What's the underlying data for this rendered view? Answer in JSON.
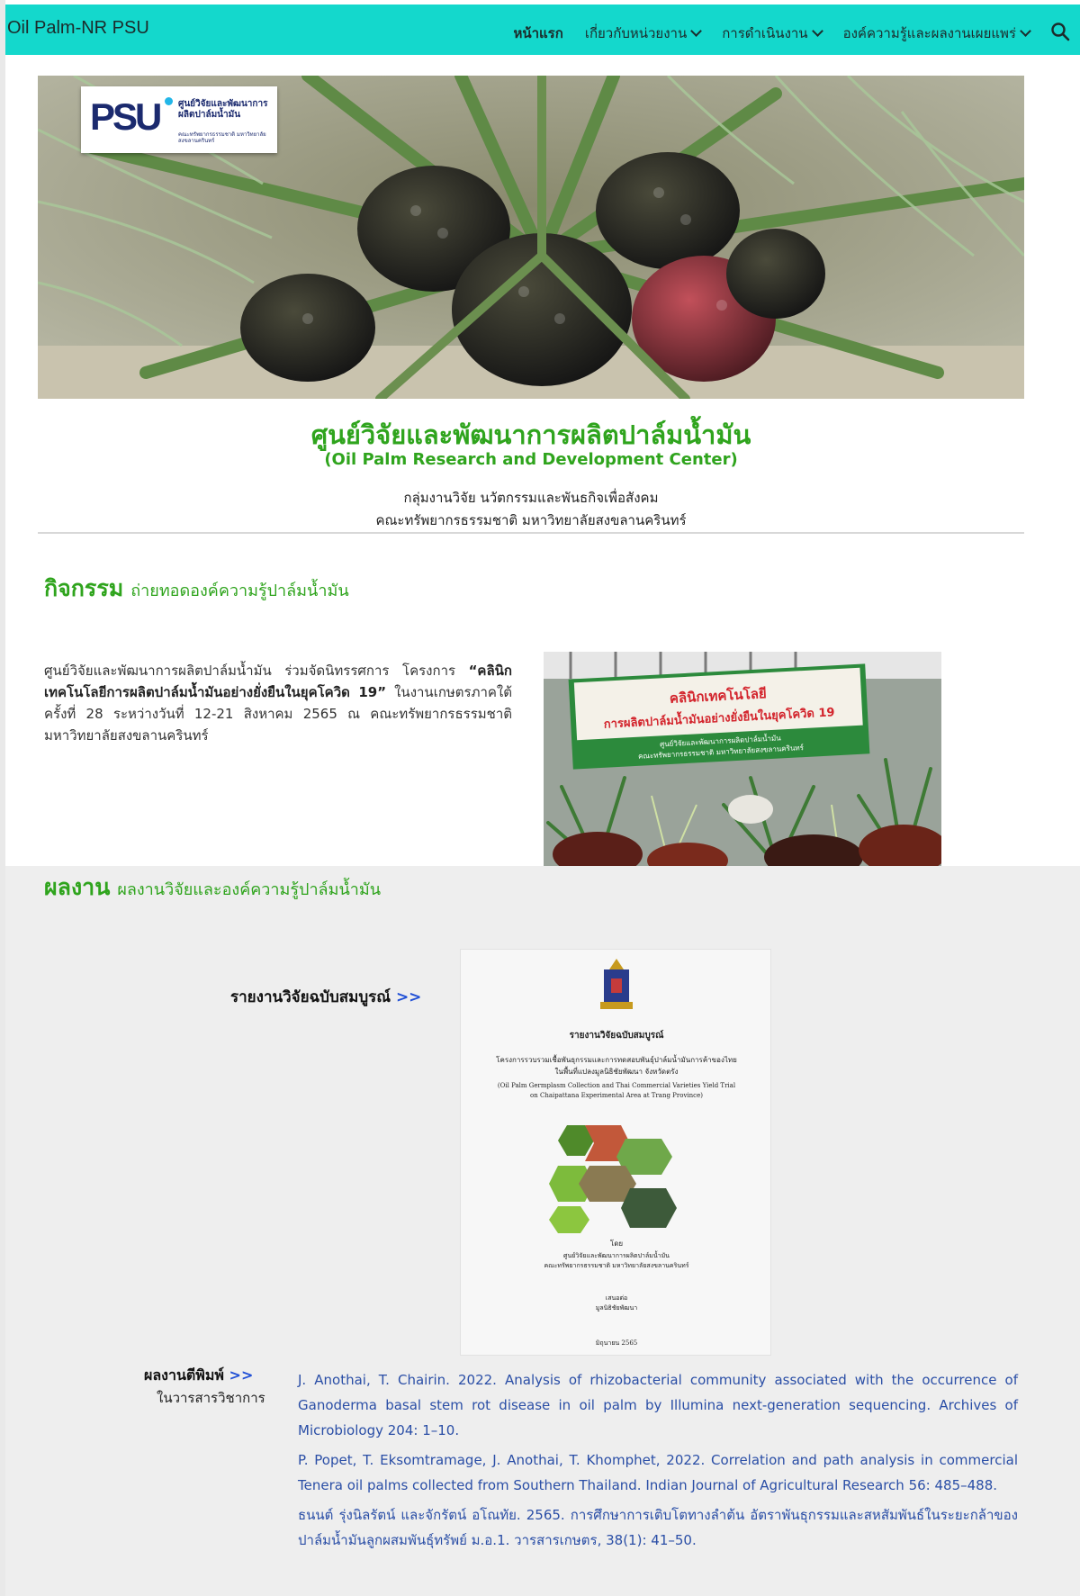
{
  "header": {
    "site_title": "Oil Palm-NR PSU",
    "nav": [
      {
        "label": "หน้าแรก",
        "active": true,
        "dropdown": false
      },
      {
        "label": "เกี่ยวกับหน่วยงาน",
        "active": false,
        "dropdown": true
      },
      {
        "label": "การดำเนินงาน",
        "active": false,
        "dropdown": true
      },
      {
        "label": "องค์ความรู้และผลงานเผยแพร่",
        "active": false,
        "dropdown": true
      }
    ],
    "search_icon": "search-icon"
  },
  "hero": {
    "logo_text": "PSU",
    "logo_caption": "ศูนย์วิจัยและพัฒนาการผลิตปาล์มน้ำมัน",
    "logo_sub": "คณะทรัพยากรธรรมชาติ มหาวิทยาลัยสงขลานครินทร์"
  },
  "center": {
    "title_th": "ศูนย์วิจัยและพัฒนาการผลิตปาล์มน้ำมัน",
    "title_en": "(Oil Palm Research and Development Center)",
    "dept_line1": "กลุ่มงานวิจัย นวัตกรรมและพันธกิจเพื่อสังคม",
    "dept_line2": "คณะทรัพยากรธรรมชาติ มหาวิทยาลัยสงขลานครินทร์"
  },
  "activity": {
    "heading_big": "กิจกรรม",
    "heading_small": "ถ่ายทอดองค์ความรู้ปาล์มน้ำมัน",
    "text_before": "ศูนย์วิจัยและพัฒนาการผลิตปาล์มน้ำมัน ร่วมจัดนิทรรศการ โครงการ ",
    "text_bold": "“คลินิกเทคโนโลยีการผลิตปาล์มน้ำมันอย่างยั่งยืนในยุคโควิด 19”",
    "text_after": " ในงานเกษตรภาคใต้ ครั้งที่ 28 ระหว่างวันที่ 12-21 สิงหาคม 2565 ณ คณะทรัพยากรธรรมชาติ มหาวิทยาลัยสงขลานครินทร์",
    "photo_sign_line1": "คลินิกเทคโนโลยี",
    "photo_sign_line2": "การผลิตปาล์มน้ำมันอย่างยั่งยืนในยุคโควิด 19",
    "photo_sign_line3": "ศูนย์วิจัยและพัฒนาการผลิตปาล์มน้ำมัน",
    "photo_sign_line4": "คณะทรัพยากรธรรมชาติ มหาวิทยาลัยสงขลานครินทร์"
  },
  "works": {
    "heading_big": "ผลงาน",
    "heading_small": "ผลงานวิจัยและองค์ความรู้ปาล์มน้ำมัน",
    "report_label": "รายงานวิจัยฉบับสมบูรณ์",
    "arrow": ">>",
    "cover": {
      "title": "รายงานวิจัยฉบับสมบูรณ์",
      "project_th_1": "โครงการรวบรวมเชื้อพันธุกรรมและการทดสอบพันธุ์ปาล์มน้ำมันการค้าของไทย",
      "project_th_2": "ในพื้นที่แปลงมูลนิธิชัยพัฒนา จังหวัดตรัง",
      "project_en_1": "(Oil Palm Germplasm Collection and Thai Commercial Varieties Yield Trial",
      "project_en_2": "on Chaipattana Experimental Area at Trang Province)",
      "by": "โดย",
      "by_org_1": "ศูนย์วิจัยและพัฒนาการผลิตปาล์มน้ำมัน",
      "by_org_2": "คณะทรัพยากรธรรมชาติ มหาวิทยาลัยสงขลานครินทร์",
      "present": "เสนอต่อ",
      "present_org": "มูลนิธิชัยพัฒนา",
      "date": "มิถุนายน 2565"
    },
    "pub_label": "ผลงานตีพิมพ์",
    "pub_sub": "ในวารสารวิชาการ",
    "publications": [
      "J. Anothai, T. Chairin. 2022. Analysis of rhizobacterial community associated with the occurrence of Ganoderma basal stem rot disease in oil palm by Illumina next-generation sequencing. Archives of Microbiology 204: 1–10.",
      "P. Popet, T. Eksomtramage, J. Anothai, T. Khomphet, 2022. Correlation and path analysis in commercial Tenera oil palms collected from Southern Thailand. Indian Journal of Agricultural Research 56: 485–488.",
      "ธนนต์ รุ่งนิลรัตน์ และจักรัตน์ อโณทัย. 2565. การศึกษาการเติบโตทางลำต้น อัตราพันธุกรรมและสหสัมพันธ์ในระยะกล้าของปาล์มน้ำมันลูกผสมพันธุ์ทรัพย์ ม.อ.1. วารสารเกษตร, 38(1): 41–50."
    ]
  },
  "colors": {
    "nav_bg": "#14d8cc",
    "accent_green": "#2fa41d",
    "link_blue": "#2a4ea6",
    "gray_bg": "#eeeeee"
  }
}
